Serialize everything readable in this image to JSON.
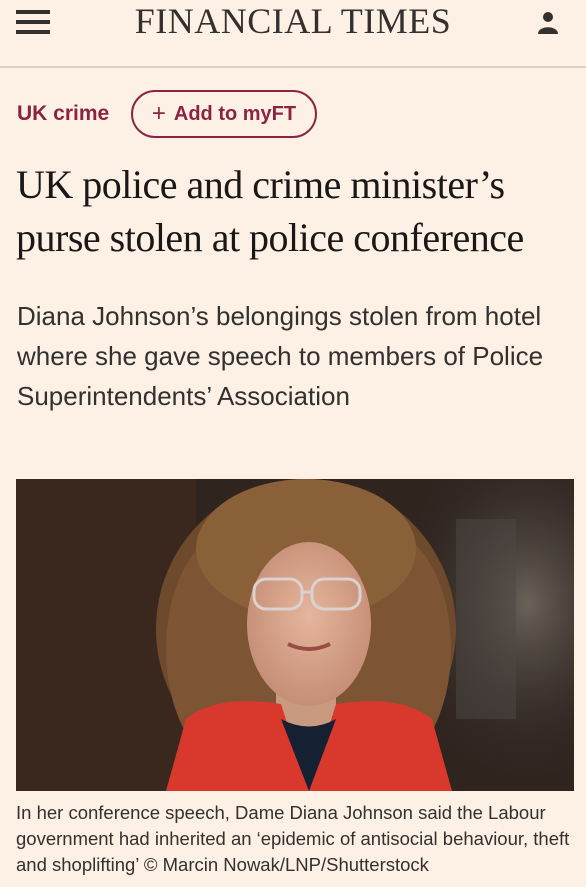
{
  "header": {
    "masthead": "FINANCIAL TIMES",
    "menu_icon": "hamburger-menu-icon",
    "account_icon": "user-icon"
  },
  "article": {
    "topic": "UK crime",
    "myft_label": "Add to myFT",
    "headline": "UK police and crime minister’s purse stolen at police conference",
    "standfirst": "Diana Johnson’s belongings stolen from hotel where she gave speech to members of Police Superintendents’ Association",
    "caption": "In her conference speech, Dame Diana Johnson said the Labour government had inherited an ‘epidemic of antisocial behaviour, theft and shoplifting’ © Marcin Nowak/LNP/Shutterstock"
  },
  "colors": {
    "background": "#fdf1e5",
    "accent": "#8a2442",
    "text": "#33302e"
  }
}
